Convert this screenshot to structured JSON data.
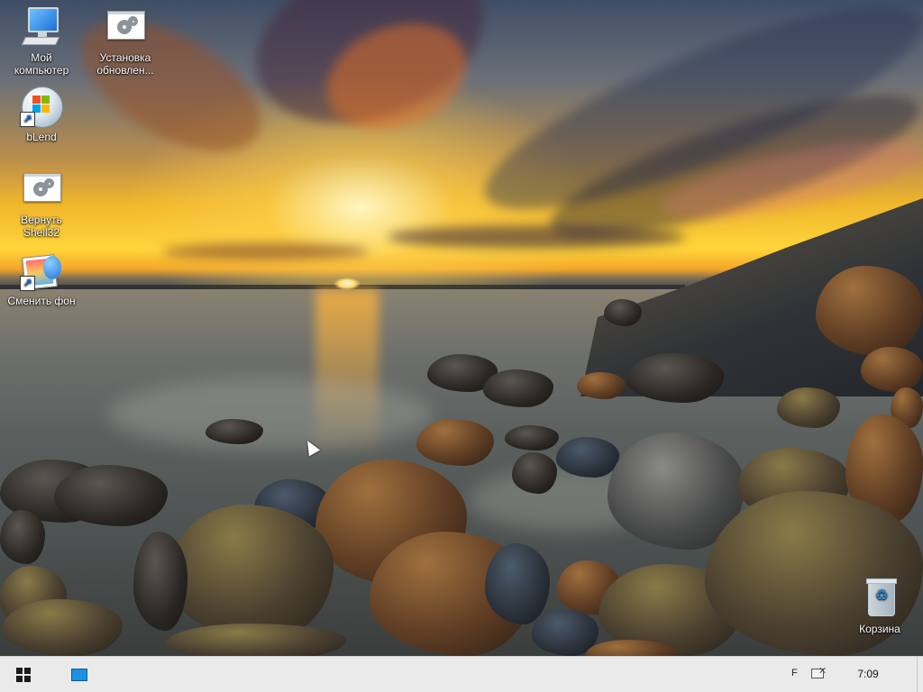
{
  "desktop": {
    "icons": [
      {
        "id": "my-computer",
        "label": "Мой компьютер",
        "icon": "computer-icon"
      },
      {
        "id": "install-updates",
        "label": "Установка обновлен...",
        "icon": "settings-window-icon"
      },
      {
        "id": "blend",
        "label": "bLend",
        "icon": "windows-globe-icon",
        "shortcut": true
      },
      {
        "id": "restore-shell32",
        "label": "Вернуть Shell32",
        "icon": "settings-window-icon"
      },
      {
        "id": "change-wallpaper",
        "label": "Сменить фон",
        "icon": "wallpaper-icon",
        "shortcut": true
      },
      {
        "id": "recycle-bin",
        "label": "Корзина",
        "icon": "recycle-bin-icon"
      }
    ]
  },
  "taskbar": {
    "start_icon": "windows-logo-icon",
    "show_desktop_icon": "desktop-icon",
    "language_indicator": "F",
    "network_icon": "network-disconnected-icon",
    "clock": "7:09"
  },
  "colors": {
    "taskbar_bg": "#eaeaea",
    "icon_text": "#ffffff"
  }
}
